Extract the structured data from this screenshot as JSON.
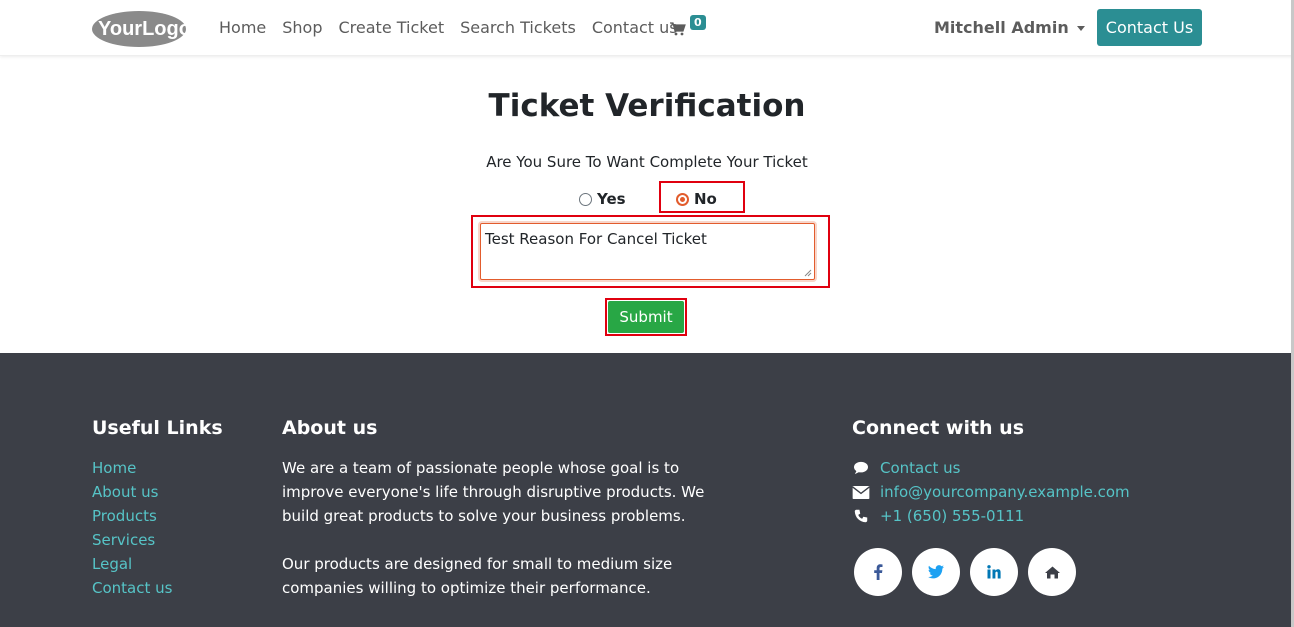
{
  "header": {
    "logo_text": "YourLogo",
    "nav": [
      "Home",
      "Shop",
      "Create Ticket",
      "Search Tickets",
      "Contact us"
    ],
    "cart_count": "0",
    "user": "Mitchell Admin",
    "contact_button": "Contact Us"
  },
  "verification": {
    "title": "Ticket Verification",
    "question": "Are You Sure To Want Complete Your Ticket",
    "options": {
      "yes": "Yes",
      "no": "No"
    },
    "selected": "No",
    "reason_value": "Test Reason For Cancel Ticket",
    "submit_label": "Submit"
  },
  "footer": {
    "useful_links": {
      "heading": "Useful Links",
      "items": [
        "Home",
        "About us",
        "Products",
        "Services",
        "Legal",
        "Contact us"
      ]
    },
    "about": {
      "heading": "About us",
      "para1": "We are a team of passionate people whose goal is to improve everyone's life through disruptive products. We build great products to solve your business problems.",
      "para2": "Our products are designed for small to medium size companies willing to optimize their performance."
    },
    "connect": {
      "heading": "Connect with us",
      "contact_link": "Contact us",
      "email": "info@yourcompany.example.com",
      "phone": "+1 (650) 555-0111",
      "socials": [
        "facebook-icon",
        "twitter-icon",
        "linkedin-icon",
        "home-icon"
      ]
    }
  },
  "colors": {
    "accent": "#2b8e93",
    "link": "#56c4c7",
    "footer_bg": "#3c3f47",
    "submit": "#28a745",
    "highlight": "#e0000f",
    "radio_checked": "#e25c2d"
  }
}
